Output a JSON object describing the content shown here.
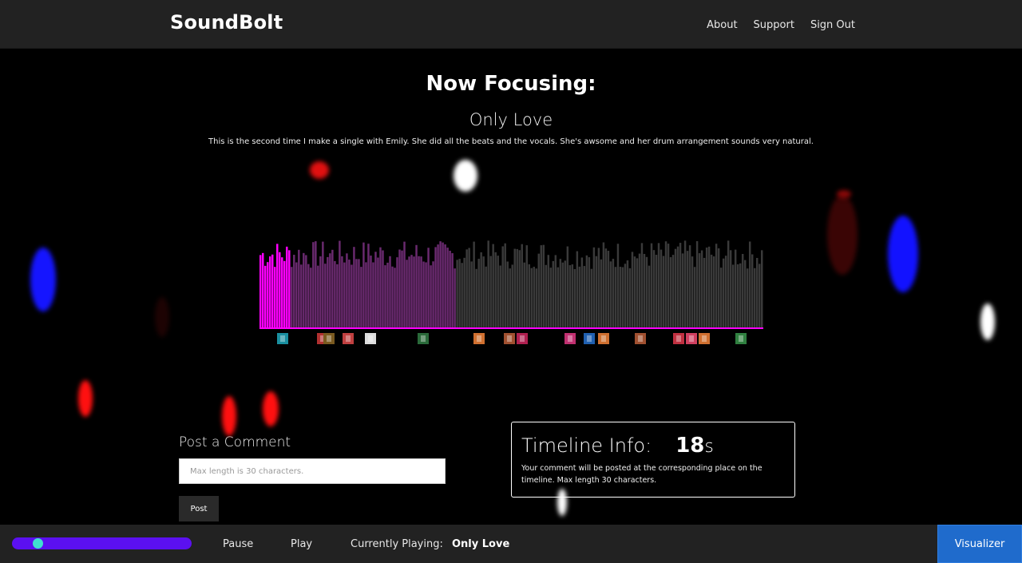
{
  "nav": {
    "brand": "SoundBolt",
    "links": [
      "About",
      "Support",
      "Sign Out"
    ]
  },
  "focus": {
    "heading": "Now Focusing:",
    "track_title": "Only Love",
    "description": "This is the second time I make a single with Emily. She did all the beats and the vocals. She's awsome and her drum arrangement sounds very natural."
  },
  "waveform": {
    "played_fraction": 0.06,
    "highlight_fraction": 0.39,
    "colors": {
      "played": "#ff00ff",
      "highlight": "#6a2a6f",
      "rest": "#3a3a3a"
    }
  },
  "comment": {
    "title": "Post a Comment",
    "placeholder": "Max length is 30 characters.",
    "post_label": "Post"
  },
  "timeline": {
    "label": "Timeline Info:",
    "value": "18",
    "unit": "s",
    "note": "Your comment will be posted at the corresponding place on the timeline. Max length 30 characters."
  },
  "player": {
    "progress_fraction": 0.06,
    "pause_label": "Pause",
    "play_label": "Play",
    "now_playing_label": "Currently Playing:",
    "now_playing_track": "Only Love",
    "visualizer_label": "Visualizer",
    "colors": {
      "track": "#5b10f0",
      "knob": "#3fe0d0"
    }
  }
}
